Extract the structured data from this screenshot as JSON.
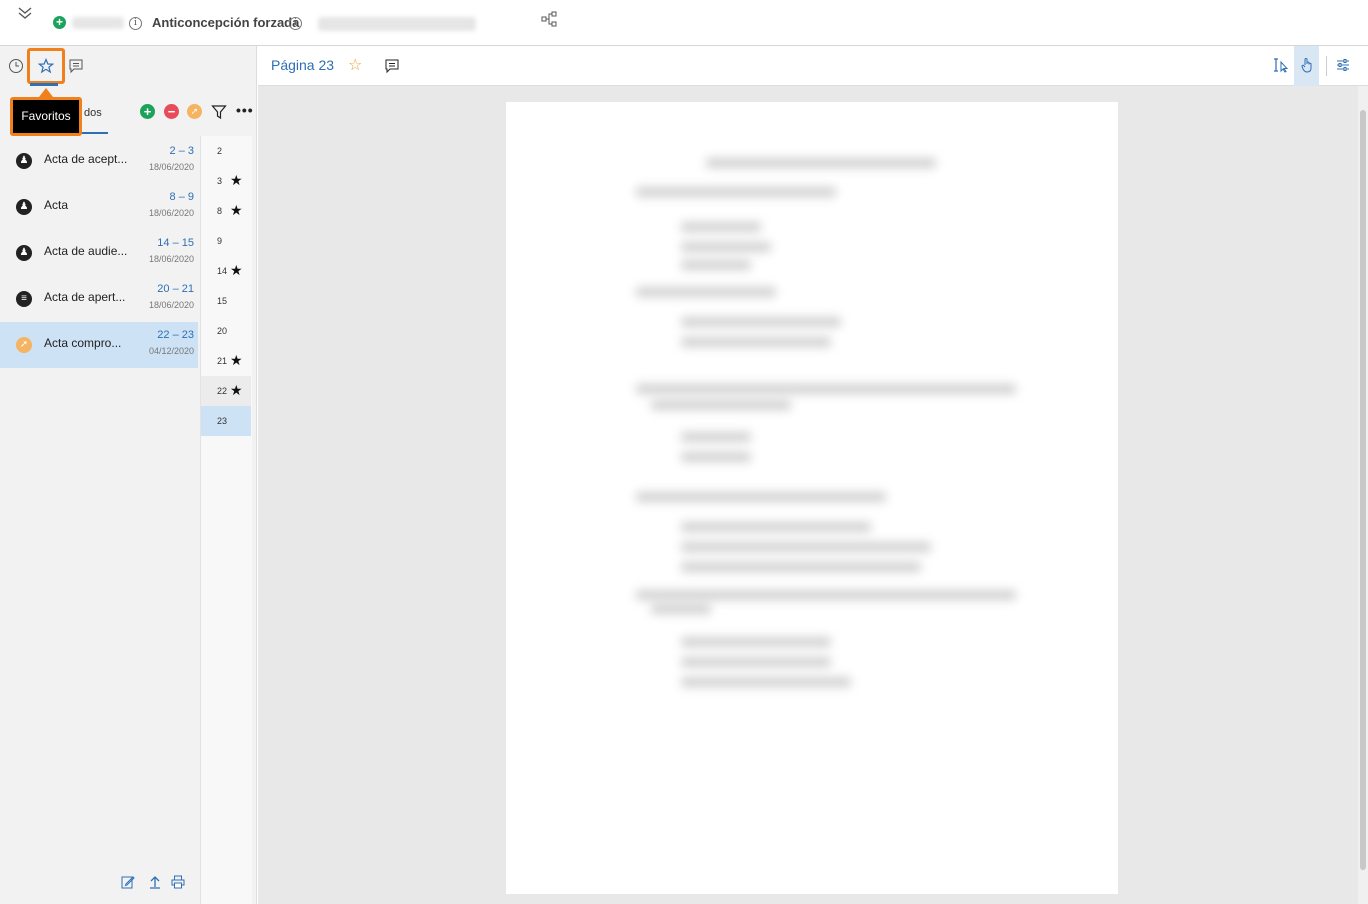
{
  "header": {
    "case_title": "Anticoncepción forzada"
  },
  "sidebar": {
    "tooltip": "Favoritos",
    "list_tab_label": "dos",
    "documents": [
      {
        "name": "Acta de acept...",
        "range": "2 – 3",
        "date": "18/06/2020",
        "icon": "stamp-icon"
      },
      {
        "name": "Acta",
        "range": "8 – 9",
        "date": "18/06/2020",
        "icon": "stamp-icon"
      },
      {
        "name": "Acta de audie...",
        "range": "14 – 15",
        "date": "18/06/2020",
        "icon": "stamp-icon"
      },
      {
        "name": "Acta de apert...",
        "range": "20 – 21",
        "date": "18/06/2020",
        "icon": "document-icon"
      },
      {
        "name": "Acta compro...",
        "range": "22 – 23",
        "date": "04/12/2020",
        "icon": "pin-icon"
      }
    ],
    "pages": [
      {
        "num": "2",
        "starred": false
      },
      {
        "num": "3",
        "starred": true
      },
      {
        "num": "8",
        "starred": true
      },
      {
        "num": "9",
        "starred": false
      },
      {
        "num": "14",
        "starred": true
      },
      {
        "num": "15",
        "starred": false
      },
      {
        "num": "20",
        "starred": false
      },
      {
        "num": "21",
        "starred": true
      },
      {
        "num": "22",
        "starred": true
      },
      {
        "num": "23",
        "starred": false
      }
    ]
  },
  "main": {
    "page_title": "Página 23"
  },
  "colors": {
    "accent": "#2e6fb5",
    "highlight": "#f0801b",
    "selected_row": "#cde2f5",
    "add": "#1ca35b",
    "remove": "#e84c5a",
    "pin": "#f5b461"
  }
}
